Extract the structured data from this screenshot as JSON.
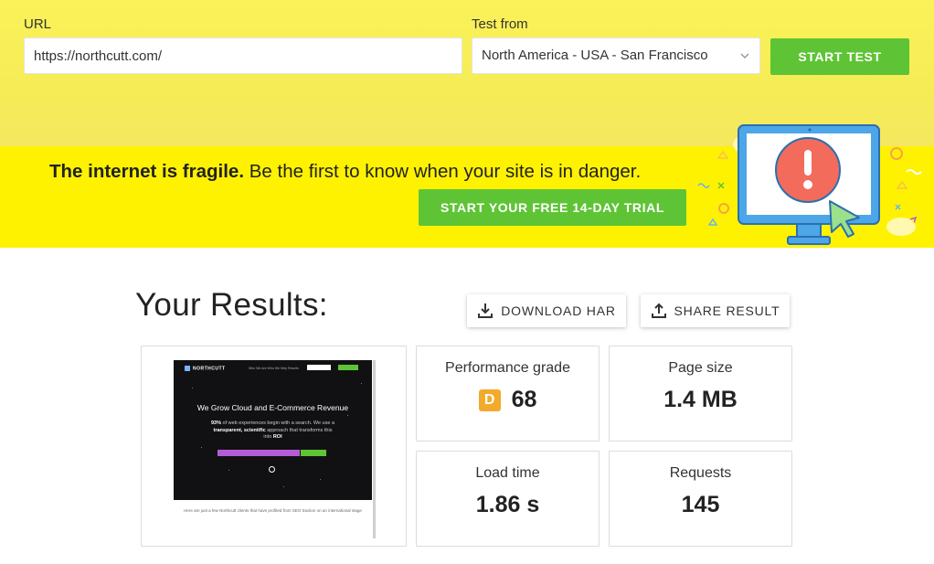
{
  "form": {
    "url_label": "URL",
    "url_value": "https://northcutt.com/",
    "test_from_label": "Test from",
    "test_from_value": "North America - USA - San Francisco",
    "start_button": "START TEST"
  },
  "promo": {
    "headline_bold": "The internet is fragile.",
    "headline_rest": " Be the first to know when your site is in danger.",
    "trial_button": "START YOUR FREE 14-DAY TRIAL"
  },
  "results": {
    "title": "Your Results:",
    "download_button": "DOWNLOAD HAR",
    "share_button": "SHARE RESULT",
    "performance_grade": {
      "label": "Performance grade",
      "grade": "D",
      "score": "68"
    },
    "page_size": {
      "label": "Page size",
      "value": "1.4 MB"
    },
    "load_time": {
      "label": "Load time",
      "value": "1.86 s"
    },
    "requests": {
      "label": "Requests",
      "value": "145"
    }
  },
  "thumbnail": {
    "brand": "NORTHCUTT",
    "nav_links": "Who We Are    Who We Help    Results",
    "headline": "We Grow Cloud and E-Commerce Revenue",
    "body_pct": "93%",
    "body_1": " of web experiences begin with a search. We use a ",
    "body_bold": "transparent, scientific",
    "body_2": " approach that transforms this into ",
    "body_roi": "ROI",
    "footer": "Here are just a few Northcutt clients that have profited from SEO traction on an international stage"
  },
  "colors": {
    "top_band": "#f6ec55",
    "promo_band": "#fff200",
    "accent_green": "#5ec435",
    "grade_d": "#f2aa2b"
  },
  "icons": [
    "chevron-down-icon",
    "download-icon",
    "share-icon",
    "monitor-alert-illustration"
  ]
}
